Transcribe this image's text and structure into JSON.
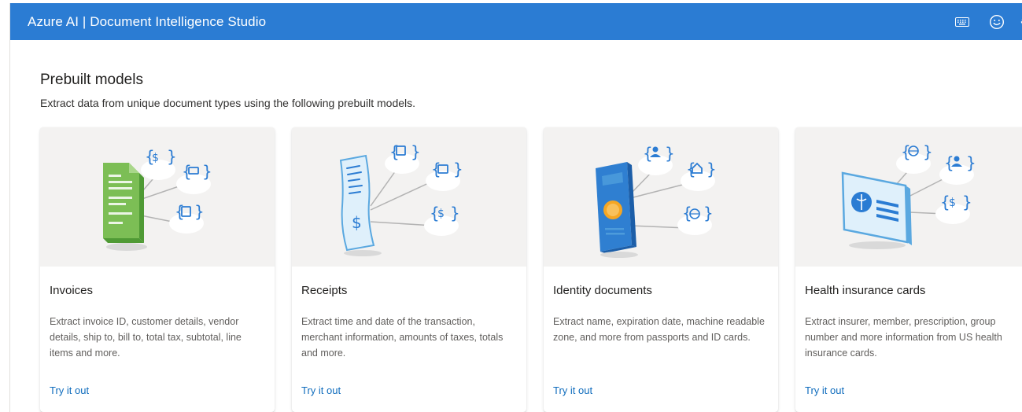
{
  "header": {
    "title": "Azure AI | Document Intelligence Studio",
    "icons": [
      "keyboard-icon",
      "smiley-feedback-icon",
      "settings-icon"
    ]
  },
  "main": {
    "title": "Prebuilt models",
    "subtitle": "Extract data from unique document types using the following prebuilt models."
  },
  "cards": [
    {
      "title": "Invoices",
      "description": "Extract invoice ID, customer details, vendor details, ship to, bill to, total tax, subtotal, line items and more.",
      "link": "Try it out",
      "illustration": "invoice-illustration"
    },
    {
      "title": "Receipts",
      "description": "Extract time and date of the transaction, merchant information, amounts of taxes, totals and more.",
      "link": "Try it out",
      "illustration": "receipt-illustration"
    },
    {
      "title": "Identity documents",
      "description": "Extract name, expiration date, machine readable zone, and more from passports and ID cards.",
      "link": "Try it out",
      "illustration": "passport-illustration"
    },
    {
      "title": "Health insurance cards",
      "description": "Extract insurer, member, prescription, group number and more information from US health insurance cards.",
      "link": "Try it out",
      "illustration": "health-card-illustration"
    }
  ],
  "colors": {
    "header_bg": "#2b7cd3",
    "link": "#0f6cbd",
    "media_bg": "#f3f2f1"
  }
}
